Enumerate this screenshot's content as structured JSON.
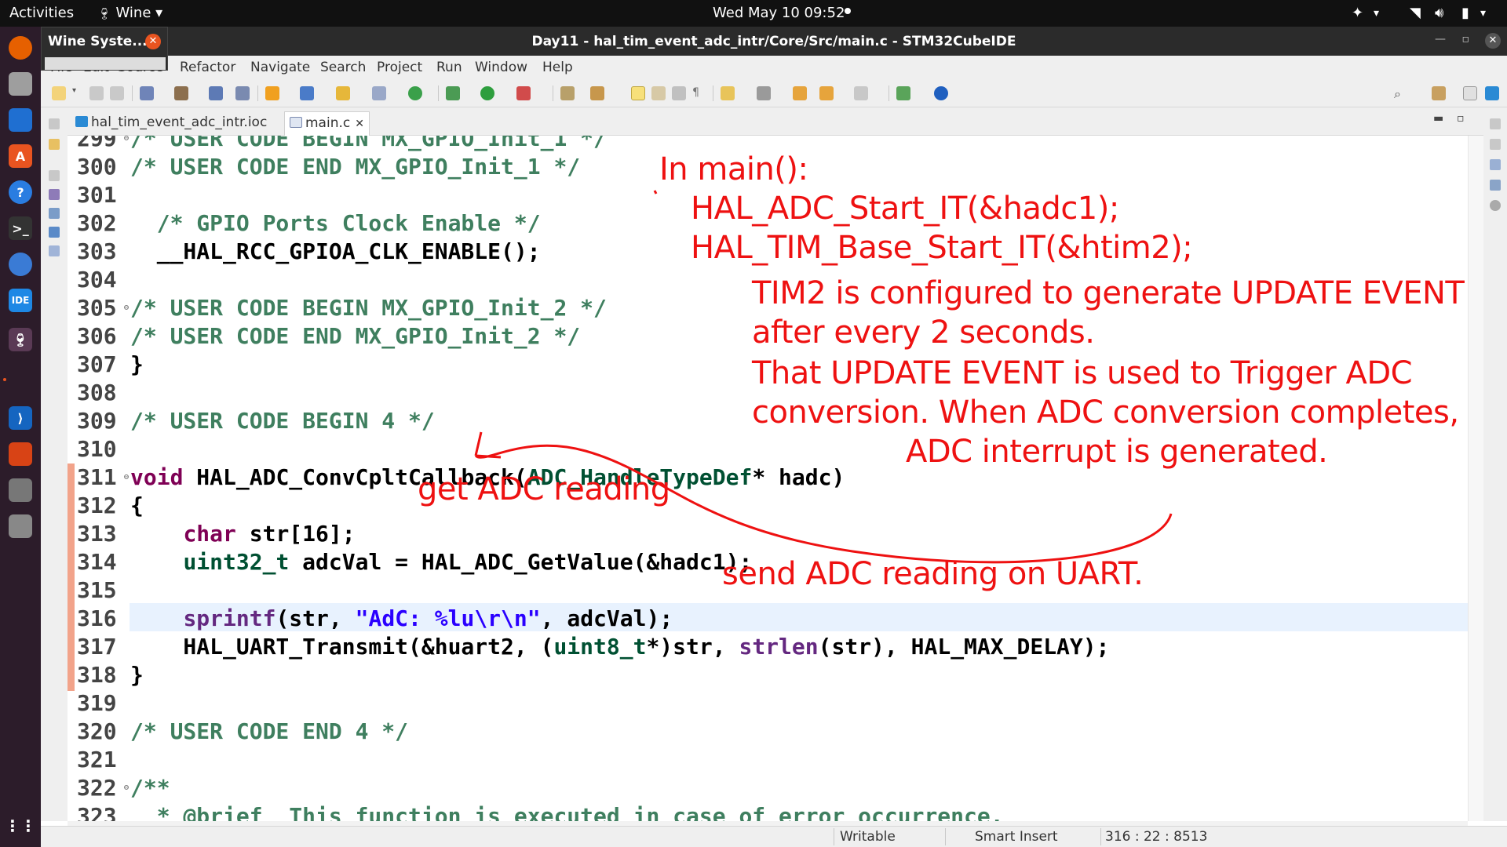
{
  "topbar": {
    "activities": "Activities",
    "app_menu": "Wine ▾",
    "clock": "Wed May 10  09:52",
    "tray": "▾"
  },
  "wine_popup": {
    "title": "Wine Syste..."
  },
  "window": {
    "title": "Day11 - hal_tim_event_adc_intr/Core/Src/main.c - STM32CubeIDE"
  },
  "menubar": {
    "items": [
      "File",
      "Edit",
      "Source",
      "Refactor",
      "Navigate",
      "Search",
      "Project",
      "Run",
      "Window",
      "Help"
    ]
  },
  "tabs": [
    {
      "label": "hal_tim_event_adc_intr.ioc",
      "icon": "mx-icon",
      "active": false
    },
    {
      "label": "main.c",
      "icon": "c-file-icon",
      "active": true,
      "close": "✕"
    }
  ],
  "editor": {
    "lines": [
      {
        "n": "299",
        "fold": true,
        "text": "/* USER CODE BEGIN MX_GPIO_Init_1 */"
      },
      {
        "n": "300",
        "fold": false,
        "text": "/* USER CODE END MX_GPIO_Init_1 */"
      },
      {
        "n": "301",
        "fold": false,
        "text": ""
      },
      {
        "n": "302",
        "fold": false,
        "text": "  /* GPIO Ports Clock Enable */"
      },
      {
        "n": "303",
        "fold": false,
        "text": "  __HAL_RCC_GPIOA_CLK_ENABLE();"
      },
      {
        "n": "304",
        "fold": false,
        "text": ""
      },
      {
        "n": "305",
        "fold": true,
        "text": "/* USER CODE BEGIN MX_GPIO_Init_2 */"
      },
      {
        "n": "306",
        "fold": false,
        "text": "/* USER CODE END MX_GPIO_Init_2 */"
      },
      {
        "n": "307",
        "fold": false,
        "text": "}"
      },
      {
        "n": "308",
        "fold": false,
        "text": ""
      },
      {
        "n": "309",
        "fold": false,
        "text": "/* USER CODE BEGIN 4 */"
      },
      {
        "n": "310",
        "fold": false,
        "text": ""
      },
      {
        "n": "311",
        "fold": true,
        "text": "void HAL_ADC_ConvCpltCallback(ADC_HandleTypeDef* hadc)"
      },
      {
        "n": "312",
        "fold": false,
        "text": "{"
      },
      {
        "n": "313",
        "fold": false,
        "text": "    char str[16];"
      },
      {
        "n": "314",
        "fold": false,
        "text": "    uint32_t adcVal = HAL_ADC_GetValue(&hadc1);"
      },
      {
        "n": "315",
        "fold": false,
        "text": ""
      },
      {
        "n": "316",
        "fold": false,
        "text": "    sprintf(str, \"AdC: %lu\\r\\n\", adcVal);"
      },
      {
        "n": "317",
        "fold": false,
        "text": "    HAL_UART_Transmit(&huart2, (uint8_t*)str, strlen(str), HAL_MAX_DELAY);"
      },
      {
        "n": "318",
        "fold": false,
        "text": "}"
      },
      {
        "n": "319",
        "fold": false,
        "text": ""
      },
      {
        "n": "320",
        "fold": false,
        "text": "/* USER CODE END 4 */"
      },
      {
        "n": "321",
        "fold": false,
        "text": ""
      },
      {
        "n": "322",
        "fold": true,
        "text": "/**"
      },
      {
        "n": "323",
        "fold": false,
        "text": "  * @brief  This function is executed in case of error occurrence."
      }
    ]
  },
  "annotations": {
    "main_title": "In main():",
    "main_line1": "HAL_ADC_Start_IT(&hadc1);",
    "main_line2": "HAL_TIM_Base_Start_IT(&htim2);",
    "explain_1": "TIM2 is configured to generate UPDATE EVENT",
    "explain_2": "after every 2 seconds.",
    "explain_3": "That UPDATE EVENT is used to Trigger ADC",
    "explain_4": "conversion. When ADC conversion completes,",
    "explain_5": "ADC interrupt is generated.",
    "get_reading": "get ADC reading",
    "send_reading": "send ADC reading on UART.",
    "color": "#ee1111"
  },
  "statusbar": {
    "mode": "Writable",
    "insert": "Smart Insert",
    "position": "316 : 22 : 8513"
  }
}
